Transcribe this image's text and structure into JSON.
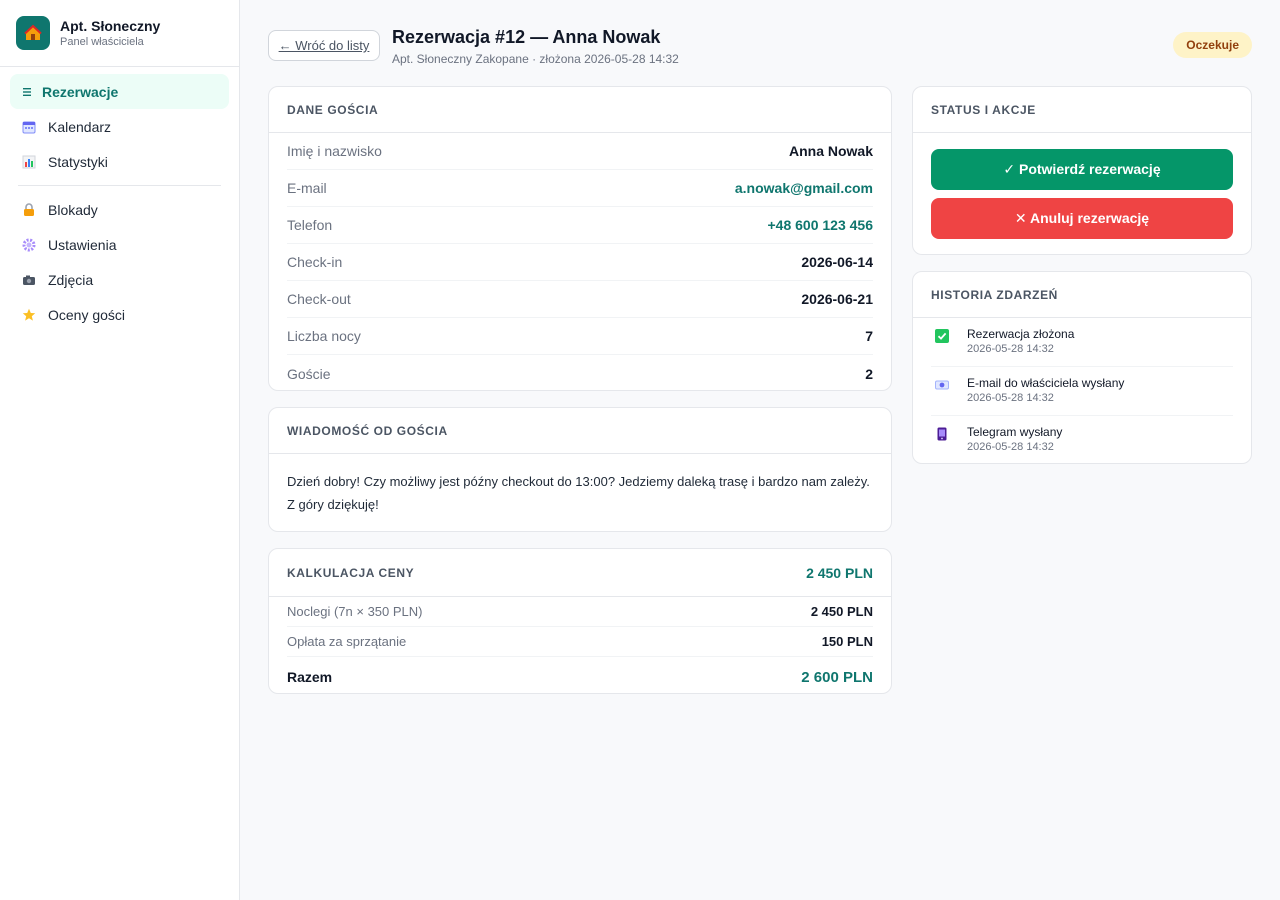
{
  "sidebar": {
    "brand_title": "Apt. Słoneczny",
    "brand_subtitle": "Panel właściciela",
    "items": [
      {
        "label": "Rezerwacje",
        "icon": "list-icon"
      },
      {
        "label": "Kalendarz",
        "icon": "calendar-icon"
      },
      {
        "label": "Statystyki",
        "icon": "bar-chart-icon"
      },
      {
        "label": "Blokady",
        "icon": "lock-icon"
      },
      {
        "label": "Ustawienia",
        "icon": "gear-icon"
      },
      {
        "label": "Zdjęcia",
        "icon": "camera-icon"
      },
      {
        "label": "Oceny gości",
        "icon": "star-icon"
      }
    ],
    "active_item": "Rezerwacje"
  },
  "header": {
    "back_label": "← Wróć do listy",
    "title": "Rezerwacja #12 — Anna Nowak",
    "subtitle": "Apt. Słoneczny Zakopane · złożona 2026-05-28 14:32",
    "status_badge": "Oczekuje"
  },
  "guest": {
    "title": "DANE GOŚCIA",
    "rows": [
      {
        "label": "Imię i nazwisko",
        "value": "Anna Nowak"
      },
      {
        "label": "E-mail",
        "value": "a.nowak@gmail.com"
      },
      {
        "label": "Telefon",
        "value": "+48 600 123 456"
      },
      {
        "label": "Check-in",
        "value": "2026-06-14"
      },
      {
        "label": "Check-out",
        "value": "2026-06-21"
      },
      {
        "label": "Liczba nocy",
        "value": "7"
      },
      {
        "label": "Goście",
        "value": "2"
      }
    ]
  },
  "message": {
    "title": "WIADOMOŚĆ OD GOŚCIA",
    "text": "Dzień dobry! Czy możliwy jest późny checkout do 13:00? Jedziemy daleką trasę i bardzo nam zależy. Z góry dziękuję!"
  },
  "pricing": {
    "title": "KALKULACJA CENY",
    "header_total": "2 450 PLN",
    "rows": [
      {
        "label": "Noclegi (7n × 350 PLN)",
        "value": "2 450 PLN"
      },
      {
        "label": "Opłata za sprzątanie",
        "value": "150 PLN"
      }
    ],
    "total_label": "Razem",
    "total_value": "2 600 PLN"
  },
  "actions": {
    "title": "STATUS I AKCJE",
    "confirm_label": "✓ Potwierdź rezerwację",
    "cancel_label": "✕ Anuluj rezerwację"
  },
  "history": {
    "title": "HISTORIA ZDARZEŃ",
    "items": [
      {
        "title": "Rezerwacja złożona",
        "time": "2026-05-28 14:32",
        "icon": "check-box-icon"
      },
      {
        "title": "E-mail do właściciela wysłany",
        "time": "2026-05-28 14:32",
        "icon": "email-icon"
      },
      {
        "title": "Telegram wysłany",
        "time": "2026-05-28 14:32",
        "icon": "phone-icon"
      }
    ]
  },
  "colors": {
    "accent": "#0f766e",
    "confirm": "#059669",
    "cancel": "#ef4444",
    "badge_bg": "#fef3c7",
    "badge_text": "#92400e"
  }
}
